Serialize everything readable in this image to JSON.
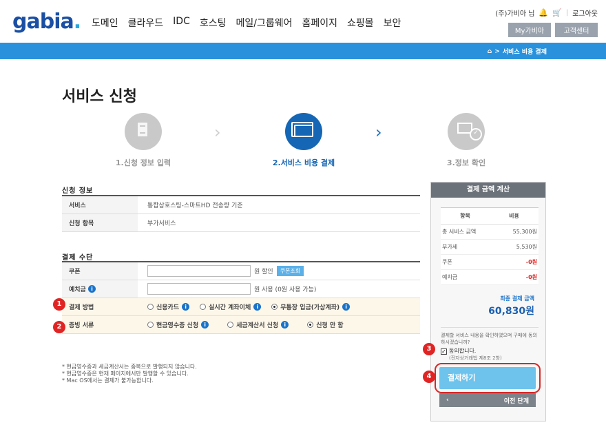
{
  "header": {
    "logo": "gabia",
    "logo_dot": ".",
    "nav": [
      "도메인",
      "클라우드",
      "IDC",
      "호스팅",
      "메일/그룹웨어",
      "홈페이지",
      "쇼핑몰",
      "보안"
    ],
    "user": "(주)가비아 님",
    "logout": "로그아웃",
    "my_btn": "My가비아",
    "support_btn": "고객센터"
  },
  "breadcrumb": {
    "sep": ">",
    "current": "서비스 비용 결제"
  },
  "page_title": "서비스 신청",
  "steps": [
    {
      "label": "1.신청 정보 입력"
    },
    {
      "label": "2.서비스 비용 결제"
    },
    {
      "label": "3.정보 확인"
    }
  ],
  "chev": "›",
  "apply_info": {
    "title": "신청 정보",
    "rows": [
      {
        "th": "서비스",
        "td": "통합상호스팅-스마트HD 전송량 기준"
      },
      {
        "th": "신청 항목",
        "td": "부가서비스"
      }
    ]
  },
  "payment": {
    "title": "결제 수단",
    "coupon_label": "쿠폰",
    "coupon_suffix": "원 할인",
    "coupon_btn": "쿠폰조회",
    "deposit_label": "예치금",
    "deposit_suffix": "원 사용 (0원 사용 가능)",
    "method_label": "결제 방법",
    "methods": [
      "신용카드",
      "실시간 계좌이체",
      "무통장 입금(가상계좌)"
    ],
    "proof_label": "증빙 서류",
    "proofs": [
      "현금영수증 신청",
      "세금계산서 신청",
      "신청 안 함"
    ],
    "info_icon": "i"
  },
  "notes": [
    "* 현금영수증과 세금계산서는 중복으로 발행되지 않습니다.",
    "* 현금영수증은 현재 페이지에서만 발행할 수 있습니다.",
    "* Mac OS에서는 결제가 불가능합니다."
  ],
  "panel": {
    "head": "결제 금액 계산",
    "col_item": "항목",
    "col_cost": "비용",
    "rows": [
      {
        "k": "총 서비스 금액",
        "v": "55,300원",
        "neg": false
      },
      {
        "k": "부가세",
        "v": "5,530원",
        "neg": false
      },
      {
        "k": "쿠폰",
        "v": "-0원",
        "neg": true
      },
      {
        "k": "예치금",
        "v": "-0원",
        "neg": true
      }
    ],
    "total_label": "최종 결제 금액",
    "total_value": "60,830원",
    "agree_text": "결제할 서비스 내용을 확인하였으며 구매에 동의하시겠습니까?",
    "agree_check": "동의합니다.",
    "agree_sub": "(전자상거래법 제8조 2항)",
    "pay_btn": "결제하기",
    "prev_btn": "이전 단계",
    "prev_arrow": "‹"
  },
  "badges": [
    "1",
    "2",
    "3",
    "4"
  ]
}
